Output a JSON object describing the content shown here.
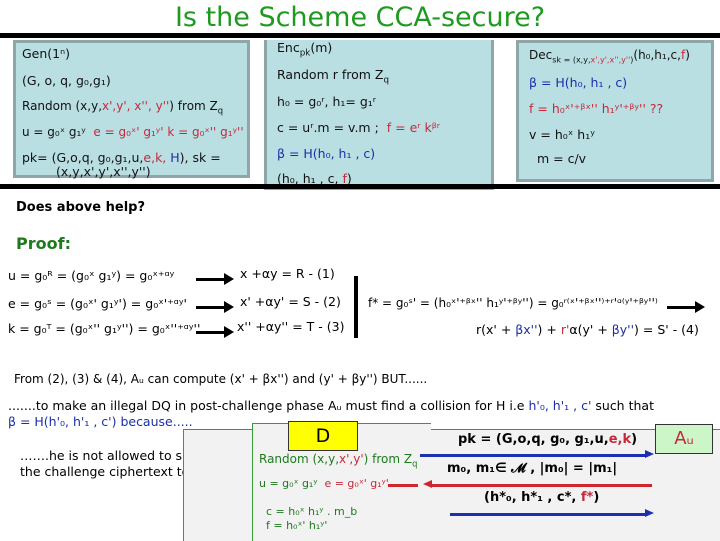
{
  "title": "Is the Scheme CCA-secure?",
  "gen_panel": {
    "line1": "Gen(1ⁿ)",
    "line2": "(G, o, q, g₀,g₁)",
    "line3_prefix": "Random (x,y,",
    "line3_red": "x',y', x'', y''",
    "line3_suffix": ") from Z",
    "line3_sub": "q",
    "line4_black": "u = g₀ˣ g₁ʸ",
    "line4_red": "e = g₀ˣ' g₁ʸ'  k = g₀ˣ'' g₁ʸ''",
    "line5_prefix": "pk= (G,o,q, g₀,g₁,u,",
    "line5_red": "e,k,",
    "line5_blue": " H",
    "line5_suffix": "), sk =",
    "line6": "(x,y,x',y',x'',y'')"
  },
  "enc_panel": {
    "line1_main": "Enc",
    "line1_sub": "pk",
    "line1_suffix": "(m)",
    "line2": "Random r from Z",
    "line2_sub": "q",
    "line3": "h₀ = g₀ʳ, h₁= g₁ʳ",
    "line4_black": "c = uʳ.m = v.m ;",
    "line4_red": "f = eʳ kᵝʳ",
    "line5_blue": "β = H(h₀, h₁ , c)",
    "line6_prefix": "(h₀, h₁ , c, ",
    "line6_red": "f",
    "line6_suffix": ")"
  },
  "dec_panel": {
    "line1_main": "Dec",
    "line1_sub_black": "sk = (x,y,",
    "line1_sub_red": "x',y',x'',y''",
    "line1_sub_end": ")",
    "line1_suffix": "(h₀,h₁,c,",
    "line1_red": "f",
    "line1_end": ")",
    "line2_blue": "β = H(h₀, h₁ , c)",
    "line3_red": "f = h₀ˣ'⁺ᵝˣ'' h₁ʸ'⁺ᵝʸ''  ??",
    "line4": "v = h₀ˣ h₁ʸ",
    "line5": "m = c/v"
  },
  "question": "Does above help?",
  "proof_label": "Proof:",
  "equations": [
    {
      "left": "u = g₀ᴿ =  (g₀ˣ g₁ʸ) = g₀ˣ⁺ᵅʸ",
      "right": "x +αy = R    - (1)"
    },
    {
      "left": "e = g₀ˢ =  (g₀ˣ' g₁ʸ') = g₀ˣ'⁺ᵅʸ'",
      "right": "x' +αy' = S  - (2)"
    },
    {
      "left": "k = g₀ᵀ =  (g₀ˣ'' g₁ʸ'') = g₀ˣ''⁺ᵅʸ''",
      "right": "x'' +αy'' = T  - (3)"
    }
  ],
  "fstar_eq": {
    "left": "f* = g₀ˢ' =  (h₀ˣ'⁺ᵝˣ'' h₁ʸ'⁺ᵝʸ'') = g₀ʳ⁽ˣ'⁺ᵝˣ''⁾⁺ʳ'ᵅ⁽ʸ'⁺ᵝʸ''⁾",
    "result_a": "r(x' + ",
    "result_b": "βx''",
    "result_c": ") + ",
    "result_d": "r'",
    "result_e": "α(y' + ",
    "result_f": "βy''",
    "result_g": ") = S'  - (4)"
  },
  "from_line": "From (2), (3) & (4), Aᵤ  can compute (x' + βx'') and (y' + βy'')  BUT......",
  "illegal_line_a": ".......to make an illegal DQ in post-challenge phase Aᵤ must find a collision for H i.e ",
  "illegal_line_b": "h'₀, h'₁ , c'",
  "illegal_line_c": "  such that",
  "because_line": "β = H(h'₀, h'₁ , c') because.....",
  "not_allowed_line1": "…….he is not allowed to submit",
  "not_allowed_line2": "the challenge ciphertext to DO",
  "game": {
    "d_label": "D",
    "a_label": "Aᵤ",
    "d_line1_prefix": "Random (x,y,",
    "d_line1_red": "x',y'",
    "d_line1_suffix": ") from Z",
    "d_line1_sub": "q",
    "d_line2_green": "u =  g₀ˣ g₁ʸ",
    "d_line2_red": "e = g₀ˣ' g₁ʸ'",
    "d_line3": "c = h₀ˣ h₁ʸ . m_b",
    "d_line4": "f = h₀ˣ' h₁ʸ'",
    "msg1_prefix": "pk = (G,o,q, g₀, g₁,u,",
    "msg1_red": "e,k",
    "msg1_suffix": ")",
    "msg2": "m₀, m₁∈  𝓜  , |m₀| = |m₁|",
    "msg3_prefix": "(h*₀, h*₁ , c*, ",
    "msg3_red": "f*",
    "msg3_suffix": ")"
  },
  "colors": {
    "title": "#1e9a1e",
    "panel_bg": "#badfe3",
    "panel_border": "#8fa6a8",
    "red": "#c8283a",
    "blue": "#1a2ea8",
    "green": "#1d7a1d",
    "d_box": "#ffff00",
    "a_box": "#ccf5c8"
  }
}
